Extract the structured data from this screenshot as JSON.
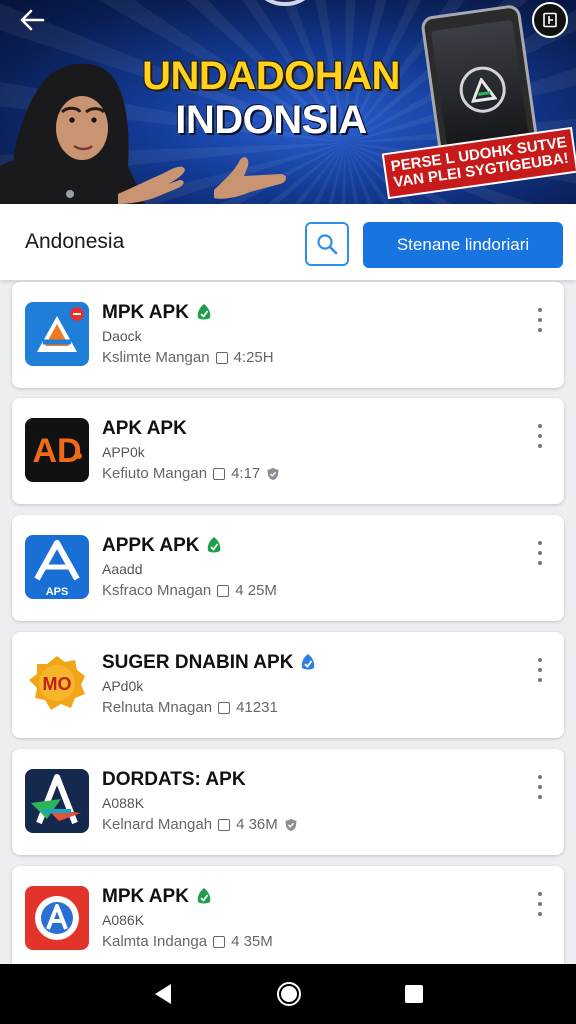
{
  "banner": {
    "headline_line1": "UNDADOHAN",
    "headline_line2": "INDONSIA",
    "ribbon_line1": "PERSE L UDOHK SUTVE",
    "ribbon_line2": "VAN PLEI SYGTIGEUBA!"
  },
  "header": {
    "title": "Andonesia",
    "primary_button": "Stenane lindoriari"
  },
  "apps": [
    {
      "name": "MPK APK",
      "sub": "Daock",
      "meta": "Kslimte Mangan",
      "size": "4:25H",
      "badge": "green",
      "icon": "triangle-a-blue-orange"
    },
    {
      "name": "APK APK",
      "sub": "APP0k",
      "meta": "Kefiuto Mangan",
      "size": "4:17",
      "badge": "gray",
      "icon": "ad-dark-orange"
    },
    {
      "name": "APPK APK",
      "sub": "Aaadd",
      "meta": "Ksfraco Mnagan",
      "size": "4 25M",
      "badge": "green",
      "icon": "aps-blue"
    },
    {
      "name": "SUGER DNABIN APK",
      "sub": "APd0k",
      "meta": "Relnuta Mnagan",
      "size": "41231",
      "badge": "blue",
      "icon": "mo-orange-badge"
    },
    {
      "name": "DORDATS: APK",
      "sub": "A088K",
      "meta": "Kelnard Mangah",
      "size": "4 36M",
      "badge": "gray",
      "icon": "a-dark-navy"
    },
    {
      "name": "MPK APK",
      "sub": "A086K",
      "meta": "Kalmta Indanga",
      "size": "4 35M",
      "badge": "green",
      "icon": "a-red-circle"
    }
  ],
  "colors": {
    "accent": "#1774e0",
    "verified_green": "#1e9e48",
    "verified_blue": "#2f7fe0"
  }
}
